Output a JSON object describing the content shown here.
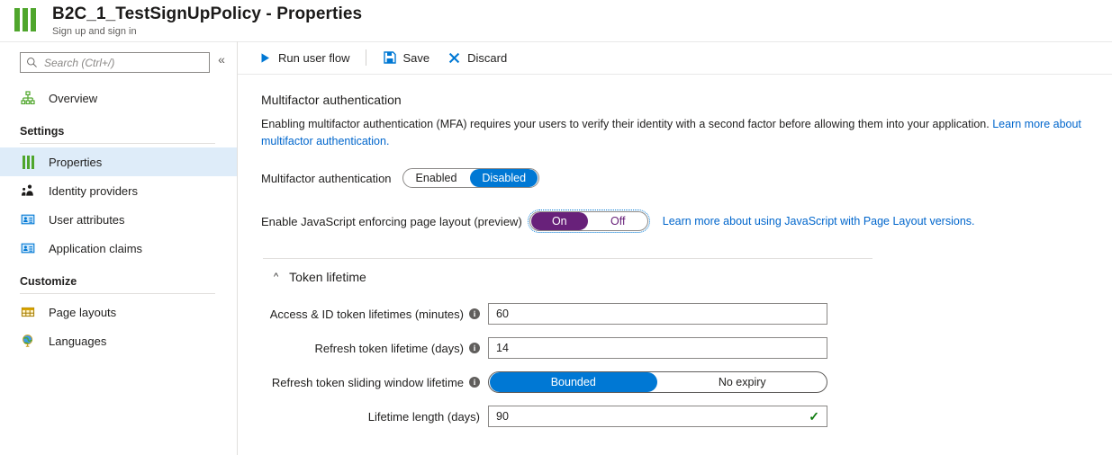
{
  "header": {
    "title": "B2C_1_TestSignUpPolicy - Properties",
    "subtitle": "Sign up and sign in",
    "brand_color": "#4fa62c"
  },
  "sidebar": {
    "search": {
      "placeholder": "Search (Ctrl+/)",
      "value": ""
    },
    "collapse_label": "«",
    "items": [
      {
        "label": "Overview",
        "icon": "hierarchy-icon",
        "selected": false
      },
      {
        "label": "Settings",
        "type": "group"
      },
      {
        "label": "Properties",
        "icon": "bars-icon",
        "selected": true
      },
      {
        "label": "Identity providers",
        "icon": "people-icon",
        "selected": false
      },
      {
        "label": "User attributes",
        "icon": "id-card-icon",
        "selected": false
      },
      {
        "label": "Application claims",
        "icon": "id-card-icon",
        "selected": false
      },
      {
        "label": "Customize",
        "type": "group"
      },
      {
        "label": "Page layouts",
        "icon": "table-icon",
        "selected": false
      },
      {
        "label": "Languages",
        "icon": "globe-icon",
        "selected": false
      }
    ]
  },
  "toolbar": {
    "run_label": "Run user flow",
    "save_label": "Save",
    "discard_label": "Discard"
  },
  "main": {
    "mfa_section": {
      "title": "Multifactor authentication",
      "description": "Enabling multifactor authentication (MFA) requires your users to verify their identity with a second factor before allowing them into your application. ",
      "link_text": "Learn more about multifactor authentication.",
      "toggle_label": "Multifactor authentication",
      "toggle_options": [
        "Enabled",
        "Disabled"
      ],
      "toggle_selected": "Disabled",
      "toggle_selected_color": "#0078d4"
    },
    "javascript_section": {
      "label": "Enable JavaScript enforcing page layout (preview)",
      "toggle_options": [
        "On",
        "Off"
      ],
      "toggle_selected": "On",
      "toggle_selected_color": "#68217a",
      "link_text": "Learn more about using JavaScript with Page Layout versions."
    },
    "token_lifetime": {
      "heading": "Token lifetime",
      "expanded": true,
      "fields": [
        {
          "label": "Access & ID token lifetimes (minutes)",
          "has_info": true,
          "type": "text",
          "value": "60",
          "valid": false
        },
        {
          "label": "Refresh token lifetime (days)",
          "has_info": true,
          "type": "text",
          "value": "14",
          "valid": false
        },
        {
          "label": "Refresh token sliding window lifetime",
          "has_info": true,
          "type": "toggle",
          "options": [
            "Bounded",
            "No expiry"
          ],
          "selected": "Bounded",
          "selected_color": "#0078d4"
        },
        {
          "label": "Lifetime length (days)",
          "has_info": false,
          "type": "text",
          "value": "90",
          "valid": true
        }
      ]
    }
  }
}
